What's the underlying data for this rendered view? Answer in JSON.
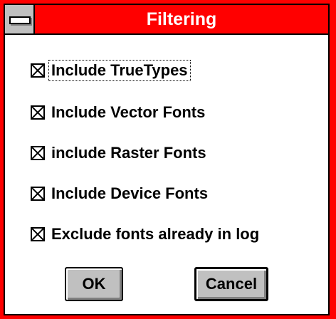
{
  "window": {
    "title": "Filtering",
    "system_menu_icon": "system-menu-icon"
  },
  "options": [
    {
      "label": "Include TrueTypes",
      "checked": true,
      "focused": true
    },
    {
      "label": "Include Vector Fonts",
      "checked": true,
      "focused": false
    },
    {
      "label": "include Raster Fonts",
      "checked": true,
      "focused": false
    },
    {
      "label": "Include Device Fonts",
      "checked": true,
      "focused": false
    },
    {
      "label": "Exclude fonts already in log",
      "checked": true,
      "focused": false
    }
  ],
  "buttons": {
    "ok_label": "OK",
    "cancel_label": "Cancel"
  },
  "colors": {
    "frame": "#ff0000",
    "title_text": "#ffffff",
    "button_face": "#c0c0c0",
    "background": "#ffffff"
  }
}
